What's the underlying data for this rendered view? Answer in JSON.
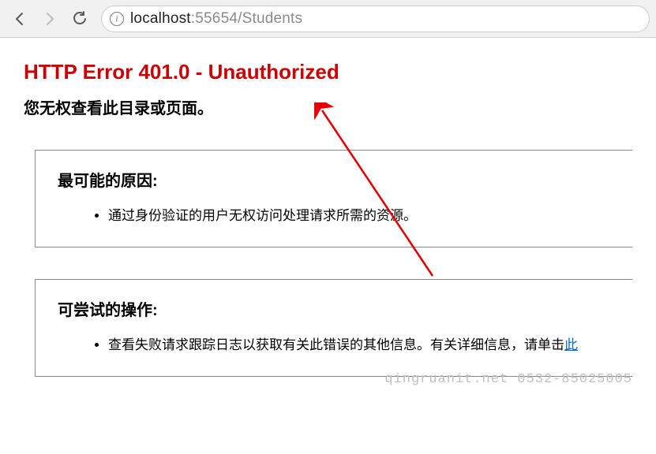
{
  "browser": {
    "url_host": "localhost",
    "url_port": ":55654",
    "url_path": "/Students"
  },
  "error": {
    "title": "HTTP Error 401.0 - Unauthorized",
    "subtitle": "您无权查看此目录或页面。"
  },
  "causes": {
    "heading": "最可能的原因:",
    "items": [
      "通过身份验证的用户无权访问处理请求所需的资源。"
    ]
  },
  "actions": {
    "heading": "可尝试的操作:",
    "item_prefix": "查看失败请求跟踪日志以获取有关此错误的其他信息。有关详细信息，请单击",
    "item_link": "此"
  },
  "watermark": "qingruanit.net 0532-85025005"
}
